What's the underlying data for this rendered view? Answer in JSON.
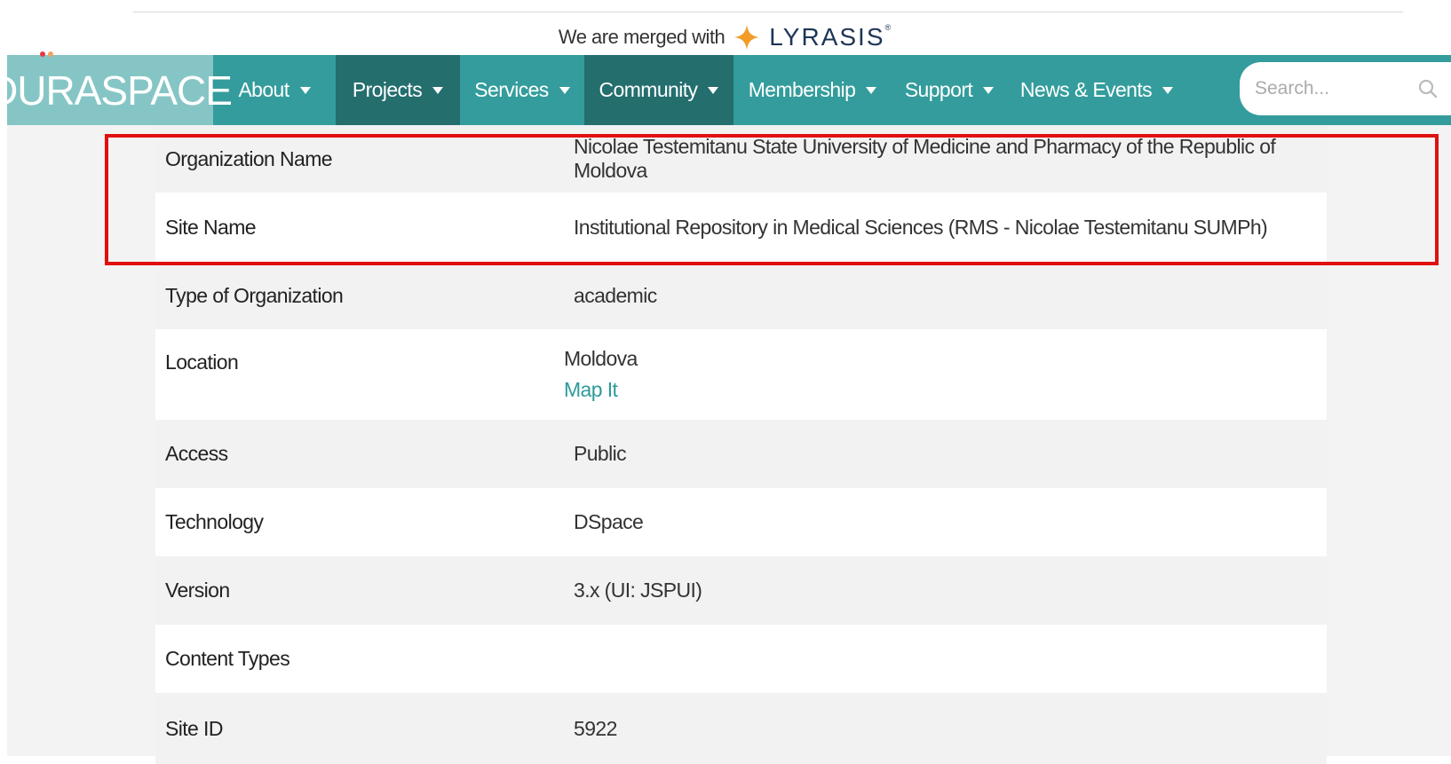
{
  "banner": {
    "merge_text": "We are merged with",
    "partner_name": "LYRASIS",
    "partner_mark": "®"
  },
  "logo": {
    "text": "DURASPACE"
  },
  "nav": {
    "items": [
      {
        "label": "About"
      },
      {
        "label": "Projects"
      },
      {
        "label": "Services"
      },
      {
        "label": "Community"
      },
      {
        "label": "Membership"
      },
      {
        "label": "Support"
      },
      {
        "label": "News & Events"
      }
    ]
  },
  "search": {
    "placeholder": "Search..."
  },
  "details": {
    "rows": [
      {
        "label": "Organization Name",
        "value": "Nicolae Testemitanu State University of Medicine and Pharmacy of the Republic of Moldova"
      },
      {
        "label": "Site Name",
        "value": "Institutional Repository in Medical Sciences (RMS - Nicolae Testemitanu SUMPh)"
      },
      {
        "label": "Type of Organization",
        "value": "academic"
      },
      {
        "label": "Location",
        "value": "Moldova",
        "link": "Map It"
      },
      {
        "label": "Access",
        "value": "Public"
      },
      {
        "label": "Technology",
        "value": "DSpace"
      },
      {
        "label": "Version",
        "value": "3.x (UI: JSPUI)"
      },
      {
        "label": "Content Types",
        "value": ""
      },
      {
        "label": "Site ID",
        "value": "5922"
      }
    ]
  },
  "colors": {
    "nav_bg": "#349c9c",
    "nav_active_bg": "#246e6e",
    "logo_bg": "#86c5c5",
    "link": "#2e9a9a",
    "highlight": "#e01010",
    "lyrasis_star": "#f39c2a"
  },
  "icons": {
    "partner_logo": "star-icon",
    "search": "search-icon",
    "dropdown": "caret-down-icon"
  }
}
